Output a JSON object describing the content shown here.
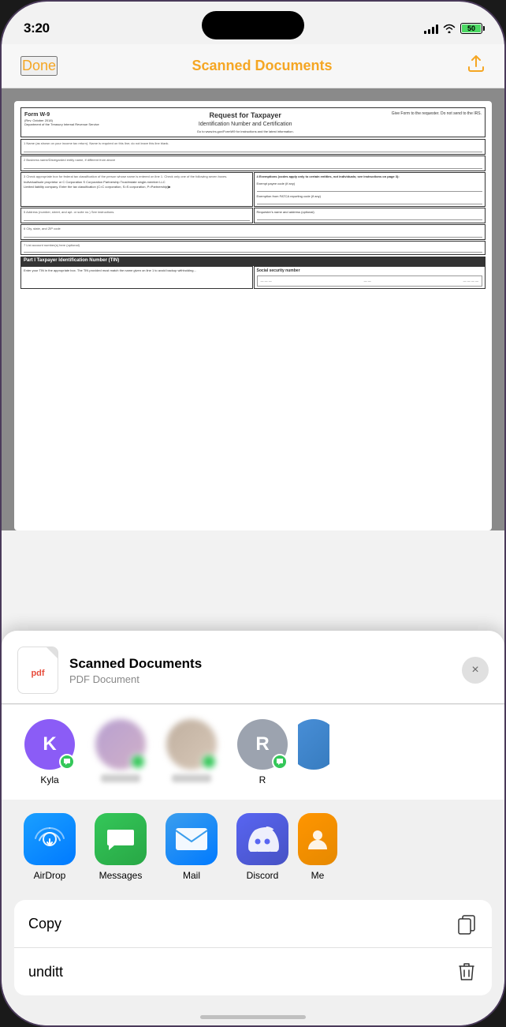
{
  "phone": {
    "status_bar": {
      "time": "3:20",
      "battery_label": "50"
    },
    "nav": {
      "done_label": "Done",
      "title": "Scanned Documents",
      "share_label": "Share"
    },
    "document": {
      "form_number": "Form W-9",
      "form_revision": "(Rev. October 2018)",
      "form_agency": "Department of the Treasury\nInternal Revenue Service",
      "title": "Request for Taxpayer",
      "subtitle": "Identification Number and Certification",
      "instruction": "Go to www.irs.gov/FormW9 for instructions and the latest information.",
      "right_text": "Give Form to the\nrequester. Do not\nsend to the IRS.",
      "field1": "1 Name (as shown on your income tax return). Name is required on this line; do not leave this line blank.",
      "field2": "2 Business name/Disregarded entity name, if different from above",
      "field3_label": "3 Check appropriate box for federal tax classification of the person whose name is entered on line 1. Check only one of the\nfollowing seven boxes.",
      "checkboxes": "Individual/sole proprietor or    C Corporation    S Corporation    Partnership    Trust/estate\nsingle-member LLC",
      "llc_note": "Limited liability company. Enter the tax classification (C=C corporation, S=S corporation, P=Partnership)▶",
      "field5": "5 Address (number, street, and apt. or suite no.) See instructions.",
      "field6": "6 City, state, and ZIP code",
      "field7": "7 List account number(s) here (optional)",
      "part1_title": "Part I   Taxpayer Identification Number (TIN)",
      "part1_text": "Enter your TIN in the appropriate box. The TIN provided must match the name given on line 1 to avoid backup withholding...",
      "ssn_label": "Social security number"
    },
    "share_sheet": {
      "doc_title": "Scanned Documents",
      "doc_type": "PDF Document",
      "close_label": "×",
      "contacts": [
        {
          "name": "Kyla",
          "initial": "K",
          "color": "purple",
          "has_badge": true
        },
        {
          "name": "",
          "initial": "",
          "color": "blurred",
          "has_badge": true
        },
        {
          "name": "",
          "initial": "",
          "color": "blurred",
          "has_badge": true
        },
        {
          "name": "R",
          "initial": "R",
          "color": "gray",
          "has_badge": true
        }
      ],
      "apps": [
        {
          "label": "AirDrop",
          "type": "airdrop"
        },
        {
          "label": "Messages",
          "type": "messages"
        },
        {
          "label": "Mail",
          "type": "mail"
        },
        {
          "label": "Discord",
          "type": "discord"
        },
        {
          "label": "Me",
          "type": "more"
        }
      ],
      "actions": [
        {
          "label": "Copy",
          "icon": "copy-icon"
        },
        {
          "label": "unditt",
          "icon": "delete-icon"
        }
      ]
    }
  }
}
